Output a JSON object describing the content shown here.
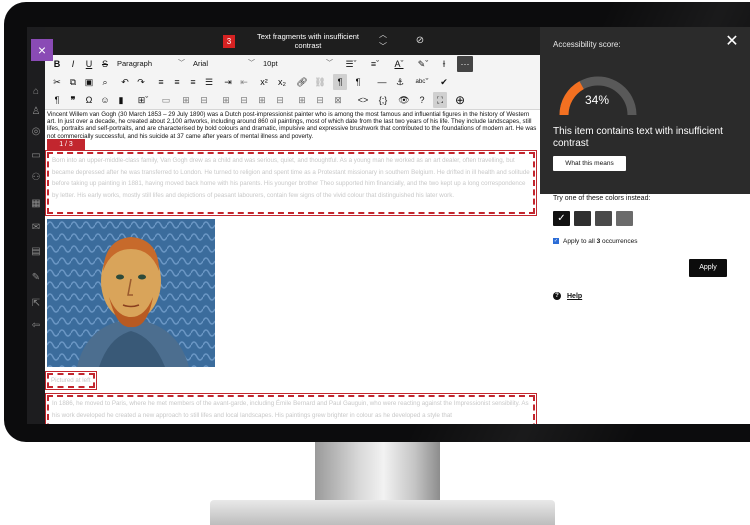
{
  "window": {
    "close_symbol": "×"
  },
  "topbar": {
    "badge_count": "3",
    "title": "Text fragments with insufficient contrast"
  },
  "toolbar": {
    "row1": {
      "bold": "B",
      "italic": "I",
      "underline": "U",
      "strike": "S",
      "paragraph_style": "Paragraph",
      "font_family": "Arial",
      "font_size": "10pt"
    },
    "row2": {
      "superscript": "x²",
      "subscript": "x₂"
    },
    "row3": {
      "source_code": "<>",
      "code_block": "{;}"
    }
  },
  "content": {
    "fragment_tag": "1 / 3",
    "intro_paragraph": "Vincent Willem van Gogh (30 March 1853 – 29 July 1890) was a Dutch post-impressionist painter who is among the most famous and influential figures in the history of Western art. In just over a decade, he created about 2,100 artworks, including around 860 oil paintings, most of which date from the last two years of his life. They include landscapes, still lifes, portraits and self-portraits, and are characterised by bold colours and dramatic, impulsive and expressive brushwork that contributed to the foundations of modern art. He was not commercially successful, and his suicide at 37 came after years of mental illness and poverty.",
    "fragment1_text": "Born into an upper-middle-class family, Van Gogh drew as a child and was serious, quiet, and thoughtful. As a young man he worked as an art dealer, often travelling, but became depressed after he was transferred to London. He turned to religion and spent time as a Protestant missionary in southern Belgium. He drifted in ill health and solitude before taking up painting in 1881, having moved back home with his parents. His younger brother Theo supported him financially, and the two kept up a long correspondence by letter. His early works, mostly still lifes and depictions of peasant labourers, contain few signs of the vivid colour that distinguished his later work.",
    "fragment2_text": "Pictured at left",
    "fragment3_text": "In 1886, he moved to Paris, where he met members of the avant-garde, including Émile Bernard and Paul Gauguin, who were reacting against the Impressionist sensibility. As his work developed he created a new approach to still lifes and local landscapes. His paintings grew brighter in colour as he developed a style that"
  },
  "panel": {
    "score_label": "Accessibility score:",
    "score": 34,
    "score_text": "34%",
    "message": "This item contains text with insufficient contrast",
    "what_button": "What this means",
    "try_label": "Try one of these colors instead:",
    "swatches": [
      "#111111",
      "#2f2f2f",
      "#4a4a4a",
      "#6b6b6b"
    ],
    "apply_all_prefix": "Apply to all ",
    "apply_all_count": "3",
    "apply_all_suffix": " occurrences",
    "apply_button": "Apply",
    "help_link": "Help"
  },
  "colors": {
    "accent_orange": "#f37021",
    "fragment_red": "#c2262e",
    "close_purple": "#8a4bb5"
  }
}
